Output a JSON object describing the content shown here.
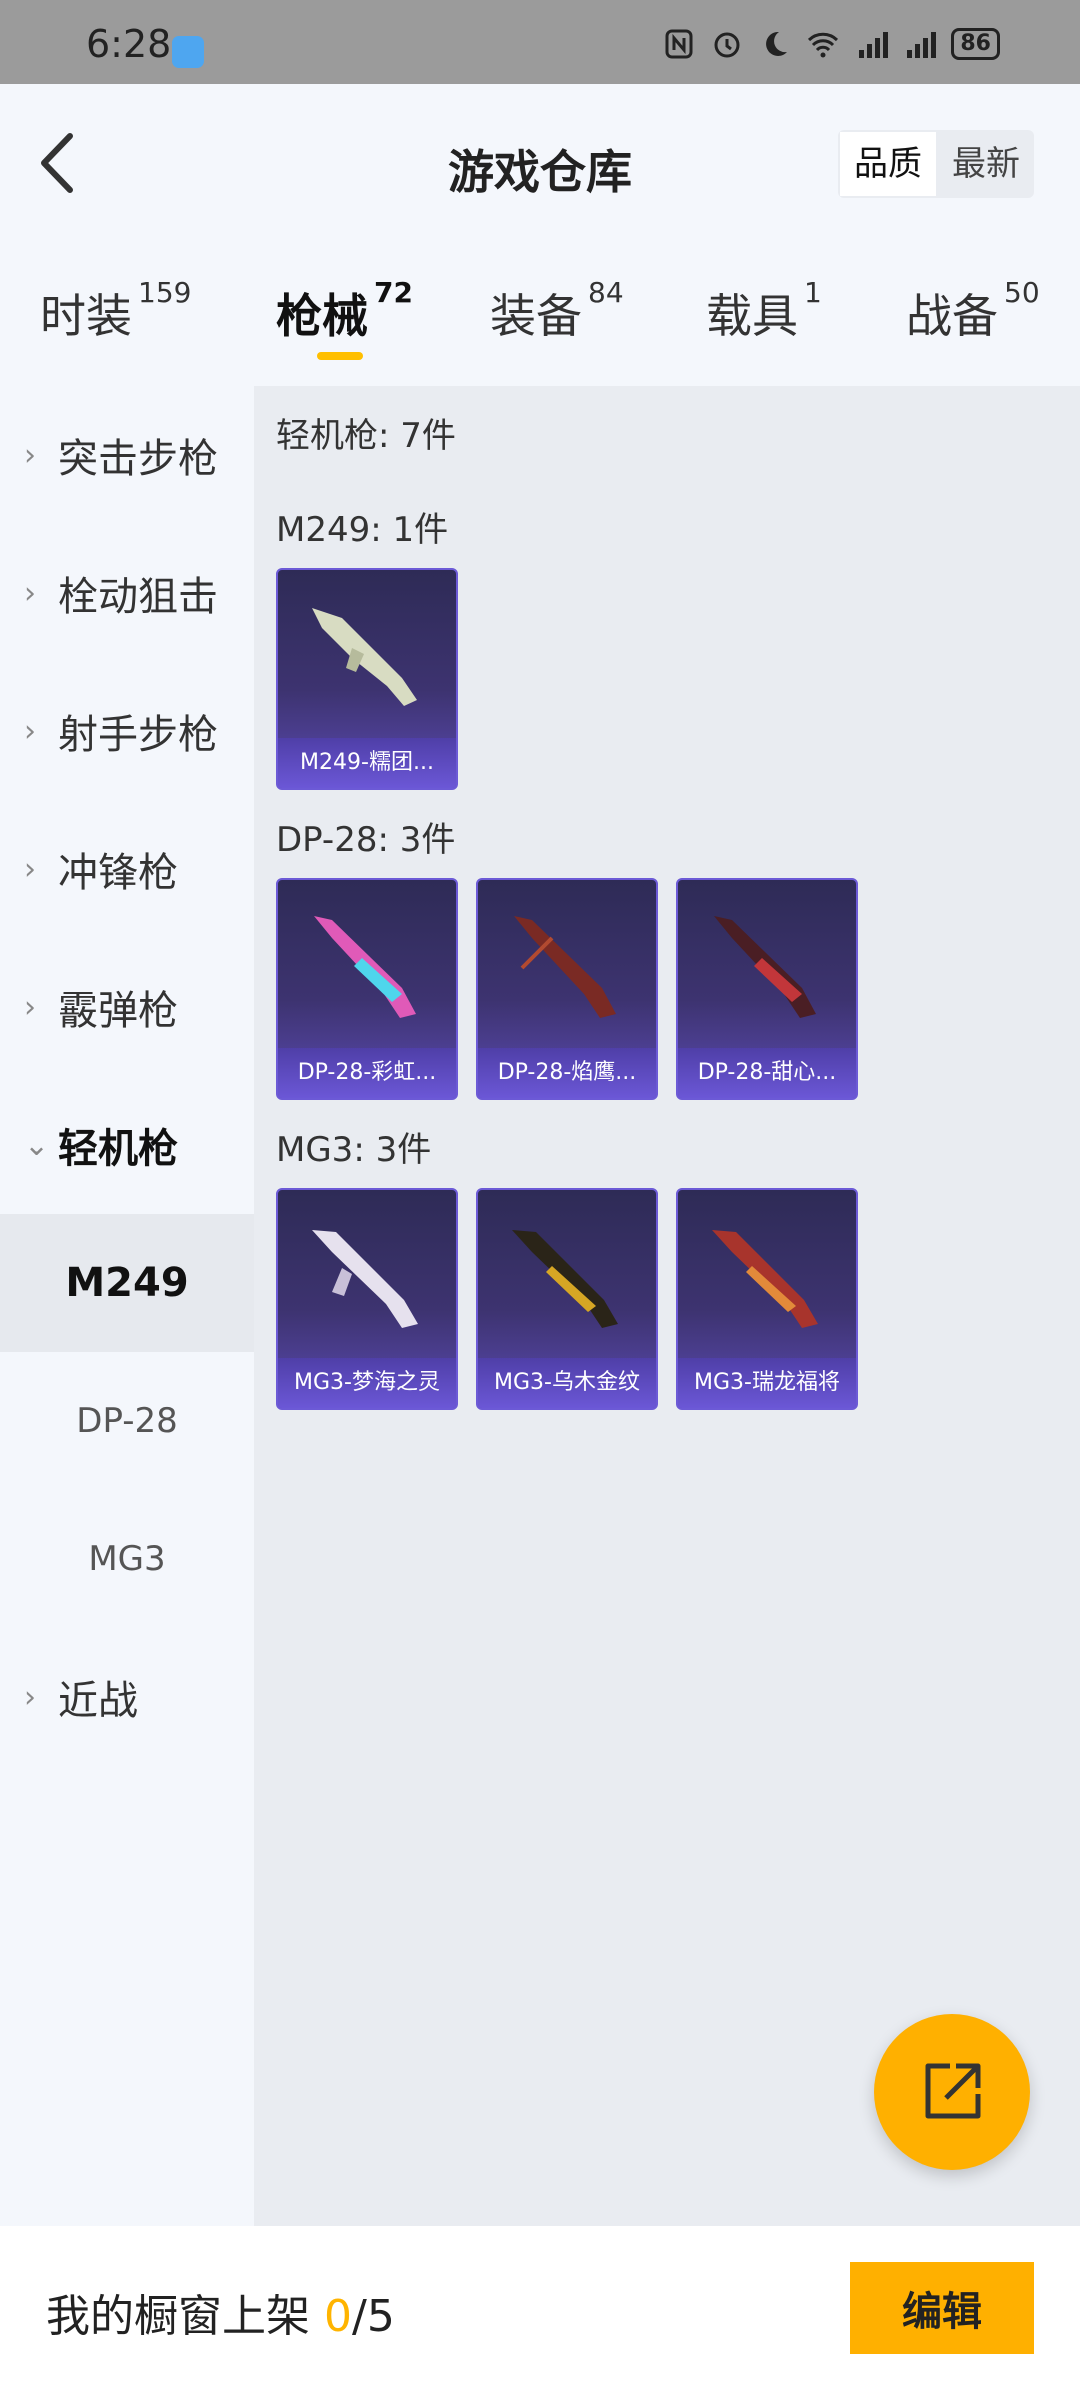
{
  "status_bar": {
    "time": "6:28",
    "battery": "86"
  },
  "header": {
    "title": "游戏仓库",
    "sort_options": [
      "品质",
      "最新"
    ],
    "active_sort": "品质"
  },
  "tabs": [
    {
      "label": "时装",
      "count": "159"
    },
    {
      "label": "枪械",
      "count": "72",
      "active": true
    },
    {
      "label": "装备",
      "count": "84"
    },
    {
      "label": "载具",
      "count": "1"
    },
    {
      "label": "战备",
      "count": "50"
    }
  ],
  "sidebar": {
    "categories": [
      "突击步枪",
      "栓动狙击",
      "射手步枪",
      "冲锋枪",
      "霰弹枪",
      "轻机枪"
    ],
    "subcategories": [
      "M249",
      "DP-28",
      "MG3"
    ],
    "selected_sub": "M249",
    "last_category": "近战"
  },
  "content": {
    "summary": "轻机枪: 7件",
    "groups": [
      {
        "heading": "M249: 1件",
        "items": [
          "M249-糯团..."
        ]
      },
      {
        "heading": "DP-28: 3件",
        "items": [
          "DP-28-彩虹...",
          "DP-28-焰鹰...",
          "DP-28-甜心..."
        ]
      },
      {
        "heading": "MG3: 3件",
        "items": [
          "MG3-梦海之灵",
          "MG3-乌木金纹",
          "MG3-瑞龙福将"
        ]
      }
    ]
  },
  "bottom_bar": {
    "label": "我的橱窗上架 ",
    "current": "0",
    "total": "/5",
    "edit_button": "编辑"
  },
  "colors": {
    "accent": "#ffb000",
    "card_bg": "#3d3370",
    "card_border": "#6c5ad6"
  }
}
